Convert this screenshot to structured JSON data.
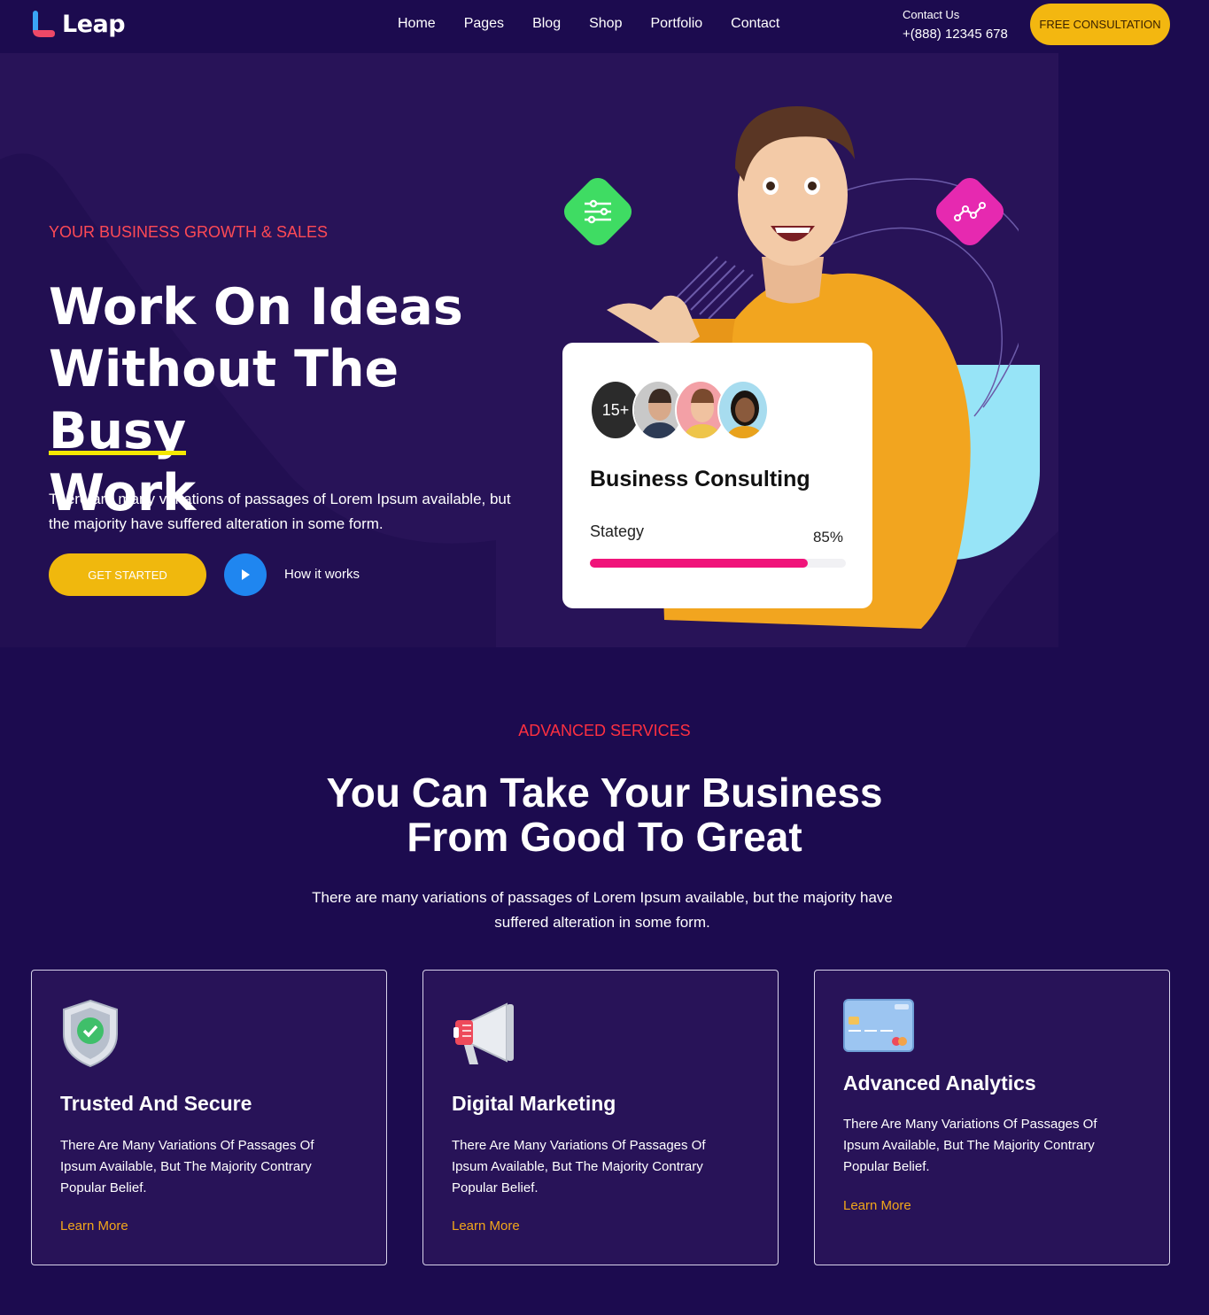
{
  "header": {
    "logo_text": "Leap",
    "nav": [
      "Home",
      "Pages",
      "Blog",
      "Shop",
      "Portfolio",
      "Contact"
    ],
    "contact_label": "Contact Us",
    "contact_phone": "+(888) 12345 678",
    "cta_label": "FREE CONSULTATION"
  },
  "hero": {
    "eyebrow": "YOUR BUSINESS GROWTH & SALES",
    "title_line1": "Work On Ideas",
    "title_line2_pre": "Without The ",
    "title_highlight": "Busy",
    "title_line3": "Work",
    "description": "There are many variations of passages of Lorem Ipsum available, but the majority have suffered alteration in some form.",
    "primary_button": "GET STARTED",
    "secondary_link": "How it works"
  },
  "card": {
    "count_badge": "15+",
    "title": "Business Consulting",
    "label": "Stategy",
    "percent": "85%",
    "progress": 0.85
  },
  "services": {
    "eyebrow": "ADVANCED SERVICES",
    "title_line1": "You Can Take Your Business",
    "title_line2": "From Good To Great",
    "description": "There are many variations of passages of Lorem Ipsum available, but the majority have suffered alteration in some form.",
    "items": [
      {
        "icon": "shield-check-icon",
        "title": "Trusted And Secure",
        "text": "There Are Many Variations Of Passages Of Ipsum Available, But The Majority Contrary Popular Belief.",
        "link": "Learn More"
      },
      {
        "icon": "megaphone-icon",
        "title": "Digital Marketing",
        "text": "There Are Many Variations Of Passages Of Ipsum Available, But The Majority Contrary Popular Belief.",
        "link": "Learn More"
      },
      {
        "icon": "credit-card-icon",
        "title": "Advanced Analytics",
        "text": "There Are Many Variations Of Passages Of Ipsum Available, But The Majority Contrary Popular Belief.",
        "link": "Learn More"
      }
    ]
  },
  "colors": {
    "background": "#1c0b4f",
    "panel": "#281358",
    "accent_yellow": "#f0b80d",
    "accent_red": "#ff4a55",
    "link_orange": "#f2a71a",
    "progress_pink": "#f0147a"
  }
}
